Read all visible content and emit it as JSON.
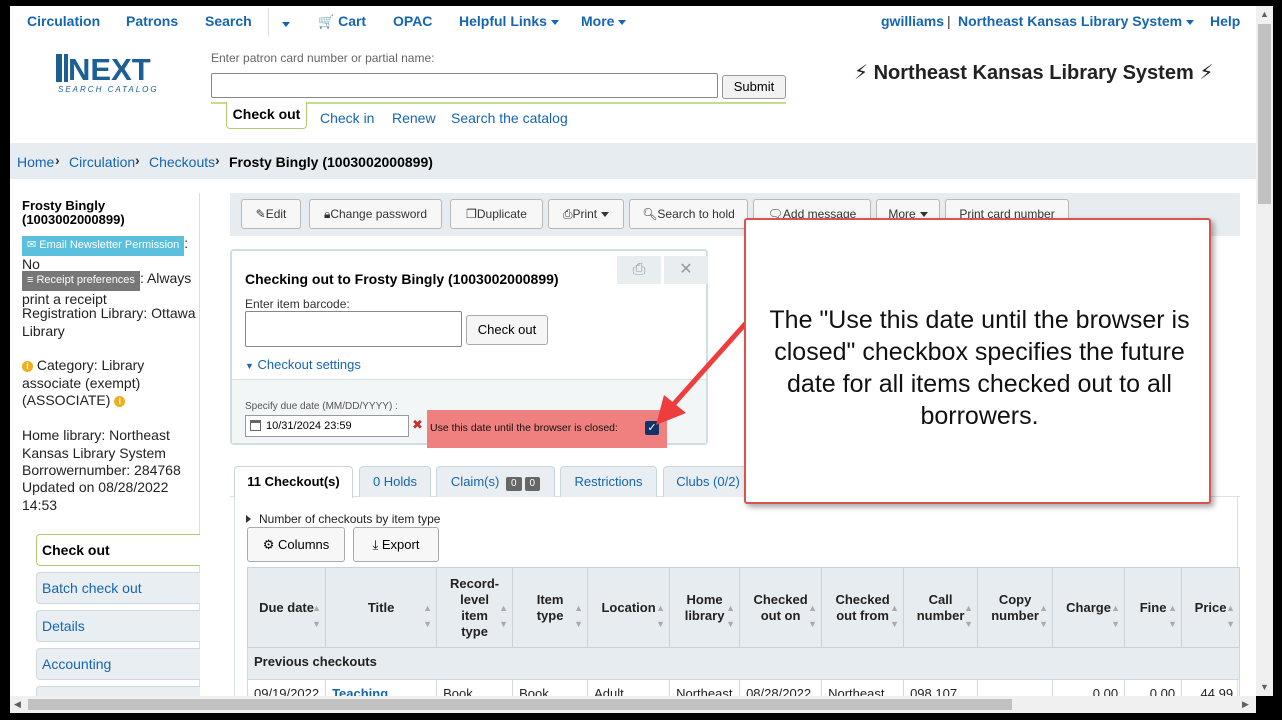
{
  "nav": {
    "items": [
      "Circulation",
      "Patrons",
      "Search",
      "Cart",
      "OPAC",
      "Helpful Links",
      "More"
    ],
    "user": "gwilliams",
    "library": "Northeast Kansas Library System",
    "help": "Help"
  },
  "header": {
    "logo_main": "NEXT",
    "logo_sub": "SEARCH CATALOG",
    "search_label": "Enter patron card number or partial name:",
    "search_value": "",
    "submit": "Submit",
    "tabs": [
      "Check out",
      "Check in",
      "Renew",
      "Search the catalog"
    ],
    "library_title": "Northeast Kansas Library System"
  },
  "breadcrumb": [
    "Home",
    "Circulation",
    "Checkouts",
    "Frosty Bingly (1003002000899)"
  ],
  "sidebar": {
    "patron_name": "Frosty Bingly",
    "patron_card": "(1003002000899)",
    "newsletter_badge": "Email Newsletter Permission",
    "newsletter_value": "No",
    "receipt_badge": "Receipt preferences",
    "receipt_value": "Always print a receipt",
    "registration": "Registration Library: Ottawa Library",
    "category": "Category: Library associate (exempt) (ASSOCIATE)",
    "home_library": "Home library: Northeast Kansas Library System",
    "borrowernumber": "Borrowernumber: 284768",
    "updated": "Updated on 08/28/2022 14:53",
    "menu": [
      "Check out",
      "Batch check out",
      "Details",
      "Accounting"
    ]
  },
  "toolbar": {
    "buttons": [
      "Edit",
      "Change password",
      "Duplicate",
      "Print",
      "Search to hold",
      "Add message",
      "More",
      "Print card number"
    ]
  },
  "checkout_panel": {
    "title": "Checking out to Frosty Bingly (1003002000899)",
    "barcode_label": "Enter item barcode:",
    "barcode_value": "",
    "checkout_button": "Check out",
    "settings_toggle": "Checkout settings",
    "due_label": "Specify due date (MM/DD/YYYY) :",
    "due_value": "10/31/2024 23:59",
    "sticky_label": "Use this date until the browser is closed:",
    "sticky_checked": true
  },
  "tabs": [
    {
      "label": "11 Checkout(s)"
    },
    {
      "label": "0 Holds"
    },
    {
      "label": "Claim(s)",
      "counts": [
        "0",
        "0"
      ]
    },
    {
      "label": "Restrictions"
    },
    {
      "label": "Clubs (0/2)"
    }
  ],
  "checkouts": {
    "by_type_toggle": "Number of checkouts by item type",
    "columns_button": "Columns",
    "export_button": "Export",
    "headers": [
      "Due date",
      "Title",
      "Record-level item type",
      "Item type",
      "Location",
      "Home library",
      "Checked out on",
      "Checked out from",
      "Call number",
      "Copy number",
      "Charge",
      "Fine",
      "Price"
    ],
    "group_label": "Previous checkouts",
    "rows": [
      [
        "09/19/2022",
        "Teaching",
        "Book",
        "Book",
        "Adult",
        "Northeast",
        "08/28/2022",
        "Northeast",
        "098.107",
        "",
        "0.00",
        "0.00",
        "44.99"
      ]
    ]
  },
  "callout": {
    "text": "The \"Use this date until the browser is closed\" checkbox specifies the future date for all items checked out to all borrowers."
  },
  "colors": {
    "link": "#1565b0",
    "callout_border": "#d9534f",
    "sticky_highlight": "#f08080",
    "breadcrumb_bg": "#e6ecef"
  }
}
